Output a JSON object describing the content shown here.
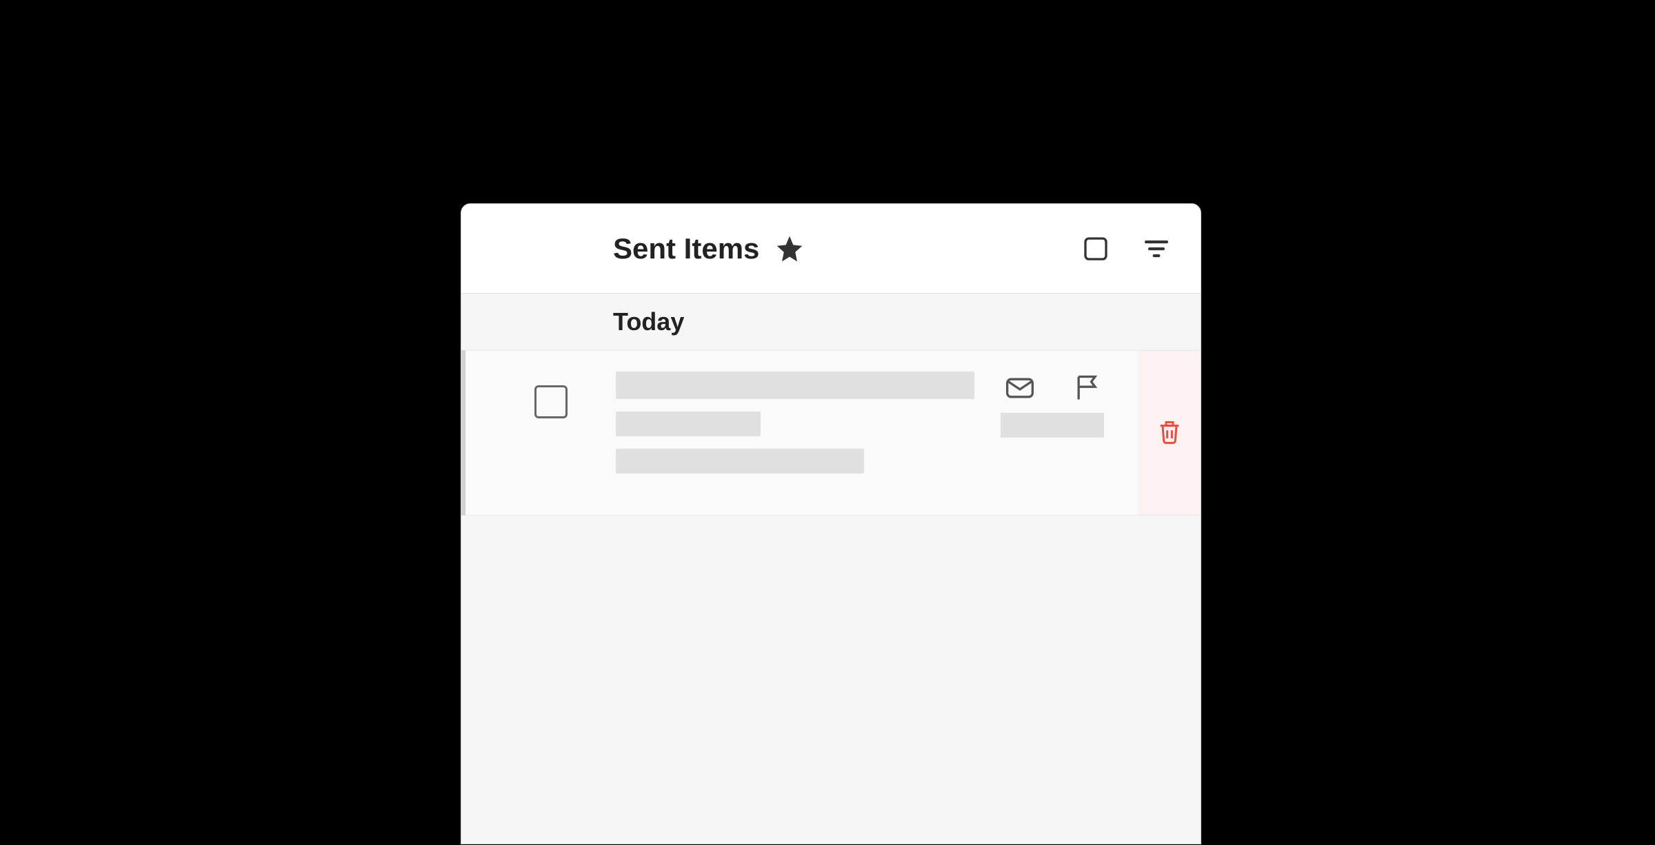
{
  "header": {
    "title": "Sent Items",
    "favorite": true
  },
  "groups": [
    {
      "label": "Today",
      "items": [
        {
          "sender": "",
          "subject": "",
          "preview": "",
          "time": "",
          "redacted": true
        }
      ]
    }
  ],
  "colors": {
    "delete_icon": "#e74c3c",
    "icon_stroke": "#333333"
  }
}
